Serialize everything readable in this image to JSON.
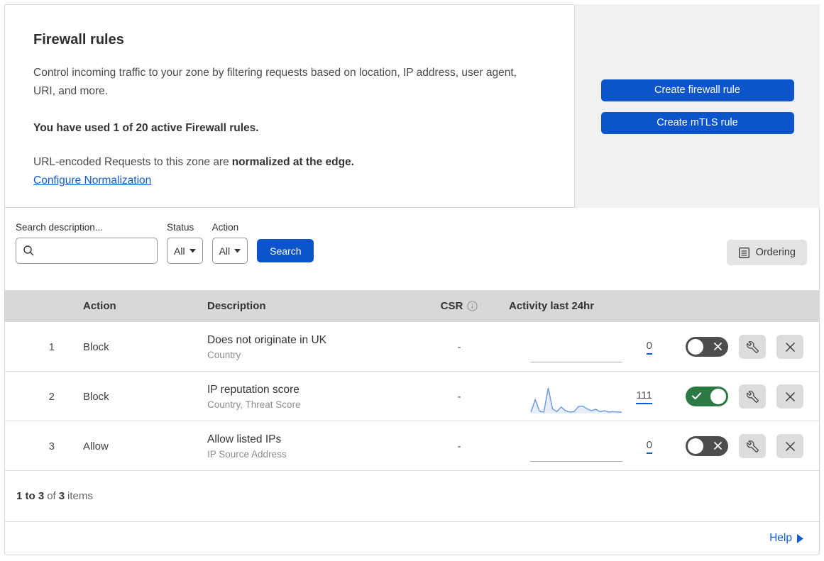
{
  "header": {
    "title": "Firewall rules",
    "description": "Control incoming traffic to your zone by filtering requests based on location, IP address, user agent, URI, and more.",
    "usage": "You have used 1 of 20 active Firewall rules.",
    "norm_prefix": "URL-encoded Requests to this zone are",
    "norm_bold": "normalized at the edge.",
    "norm_link": "Configure Normalization",
    "create_firewall": "Create firewall rule",
    "create_mtls": "Create mTLS rule"
  },
  "filters": {
    "search_label": "Search description...",
    "search_value": "",
    "status_label": "Status",
    "status_value": "All",
    "action_label": "Action",
    "action_value": "All",
    "search_button": "Search",
    "ordering_button": "Ordering"
  },
  "table": {
    "columns": {
      "action": "Action",
      "description": "Description",
      "csr": "CSR",
      "activity": "Activity last 24hr"
    },
    "rows": [
      {
        "priority": "1",
        "action": "Block",
        "description": "Does not originate in UK",
        "fields": "Country",
        "csr": "-",
        "activity_count": "0",
        "enabled": false,
        "sparkline": null
      },
      {
        "priority": "2",
        "action": "Block",
        "description": "IP reputation score",
        "fields": "Country, Threat Score",
        "csr": "-",
        "activity_count": "111",
        "enabled": true,
        "sparkline": [
          3,
          30,
          5,
          3,
          55,
          10,
          4,
          14,
          6,
          3,
          4,
          15,
          16,
          10,
          6,
          9,
          4,
          6,
          3,
          4,
          3,
          3
        ]
      },
      {
        "priority": "3",
        "action": "Allow",
        "description": "Allow listed IPs",
        "fields": "IP Source Address",
        "csr": "-",
        "activity_count": "0",
        "enabled": false,
        "sparkline": null
      }
    ]
  },
  "footer": {
    "range": "1 to 3",
    "of": "of",
    "total": "3",
    "items": "items",
    "help": "Help"
  },
  "icons": {
    "search": "magnifier-icon",
    "info": "info-circle-icon",
    "ordering": "list-document-icon",
    "edit": "wrench-icon",
    "delete": "x-icon",
    "toggle_on": "check-icon",
    "toggle_off": "x-icon",
    "help": "arrow-right-icon"
  },
  "colors": {
    "primary_blue": "#0b54cb",
    "link_blue": "#0f5bd4",
    "toggle_on_green": "#2b7a44",
    "toggle_off_gray": "#4d4d4d",
    "header_band_gray": "#d8d8d8",
    "side_panel_gray": "#f1f1f1",
    "sparkline_blue": "#6f9de0"
  }
}
